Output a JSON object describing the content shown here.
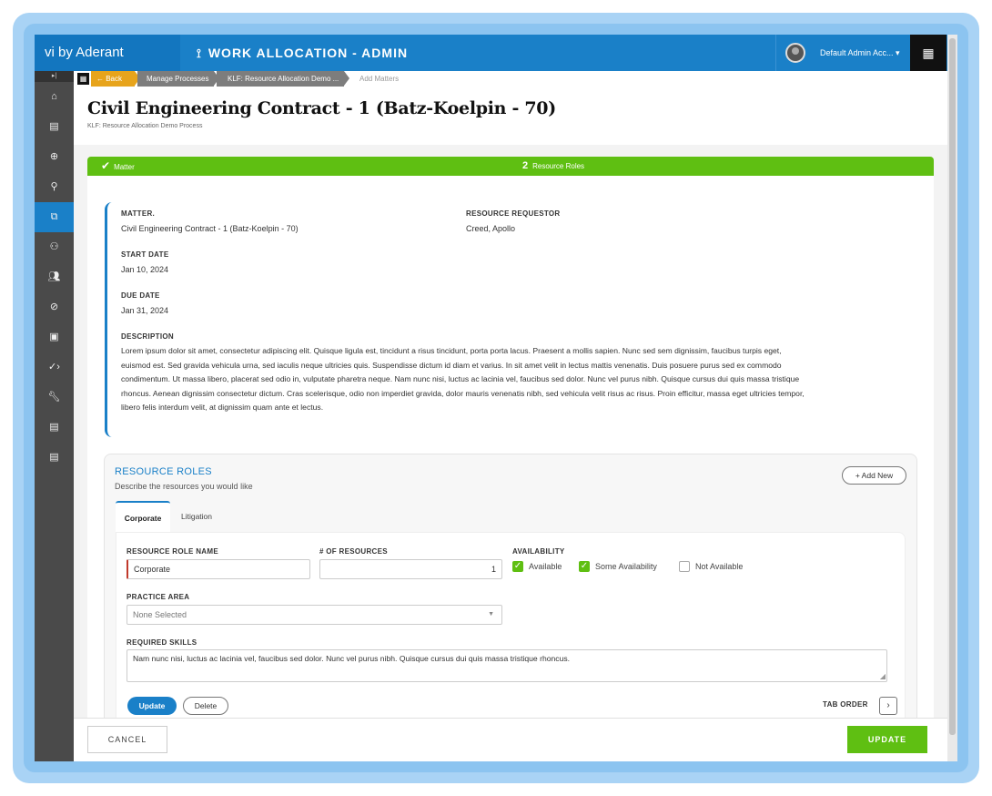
{
  "app": {
    "brand": "vi by Aderant",
    "title": "WORK ALLOCATION - ADMIN",
    "user": "Default Admin Acc...  ▾"
  },
  "sidebar": {
    "toggle": "▸|",
    "items": [
      "home-icon",
      "report-icon",
      "add-circle-icon",
      "search-icon",
      "matters-icon",
      "org-chart-icon",
      "people-icon",
      "check-circle-icon",
      "documents-icon",
      "approve-icon",
      "wrench-icon",
      "report2-icon",
      "report3-icon"
    ]
  },
  "breadcrumb": {
    "back": "← Back",
    "items": [
      "Manage Processes",
      "KLF: Resource Allocation Demo ...",
      "Add Matters"
    ]
  },
  "page": {
    "title": "Civil Engineering Contract - 1 (Batz-Koelpin - 70)",
    "subtitle": "KLF: Resource Allocation Demo Process"
  },
  "steps": {
    "step1": "Matter",
    "step2_num": "2",
    "step2": "Resource Roles"
  },
  "matter": {
    "matter_label": "MATTER.",
    "matter_value": "Civil Engineering Contract - 1 (Batz-Koelpin - 70)",
    "requestor_label": "RESOURCE REQUESTOR",
    "requestor_value": "Creed, Apollo",
    "start_label": "START DATE",
    "start_value": "Jan 10, 2024",
    "due_label": "DUE DATE",
    "due_value": "Jan 31, 2024",
    "desc_label": "DESCRIPTION",
    "description": "Lorem ipsum dolor sit amet, consectetur adipiscing elit. Quisque ligula est, tincidunt a risus tincidunt, porta porta lacus. Praesent a mollis sapien. Nunc sed sem dignissim, faucibus turpis eget, euismod est. Sed gravida vehicula urna, sed iaculis neque ultricies quis. Suspendisse dictum id diam et varius. In sit amet velit in lectus mattis venenatis. Duis posuere purus sed ex commodo condimentum. Ut massa libero, placerat sed odio in, vulputate pharetra neque. Nam nunc nisi, luctus ac lacinia vel, faucibus sed dolor. Nunc vel purus nibh. Quisque cursus dui quis massa tristique rhoncus. Aenean dignissim consectetur dictum. Cras scelerisque, odio non imperdiet gravida, dolor mauris venenatis nibh, sed vehicula velit risus ac risus. Proin efficitur, massa eget ultricies tempor, libero felis interdum velit, at dignissim quam ante et lectus."
  },
  "roles": {
    "title": "RESOURCE ROLES",
    "subtitle": "Describe the resources you would like",
    "add_new": "+ Add New",
    "tabs": [
      "Corporate",
      "Litigation"
    ],
    "form": {
      "name_label": "RESOURCE ROLE NAME",
      "name_value": "Corporate",
      "count_label": "# OF RESOURCES",
      "count_value": "1",
      "avail_label": "AVAILABILITY",
      "availability": [
        {
          "label": "Available",
          "checked": true
        },
        {
          "label": "Some Availability",
          "checked": true
        },
        {
          "label": "Not Available",
          "checked": false
        }
      ],
      "practice_label": "PRACTICE AREA",
      "practice_value": "None Selected",
      "skills_label": "REQUIRED SKILLS",
      "skills_value": "Nam nunc nisi, luctus ac lacinia vel, faucibus sed dolor. Nunc vel purus nibh. Quisque cursus dui quis massa tristique rhoncus.",
      "update": "Update",
      "delete": "Delete",
      "tab_order": "TAB ORDER"
    }
  },
  "footer": {
    "cancel": "CANCEL",
    "update": "UPDATE"
  },
  "colors": {
    "primary": "#1a80c8",
    "success": "#5fbf12",
    "back": "#e7a41c"
  }
}
